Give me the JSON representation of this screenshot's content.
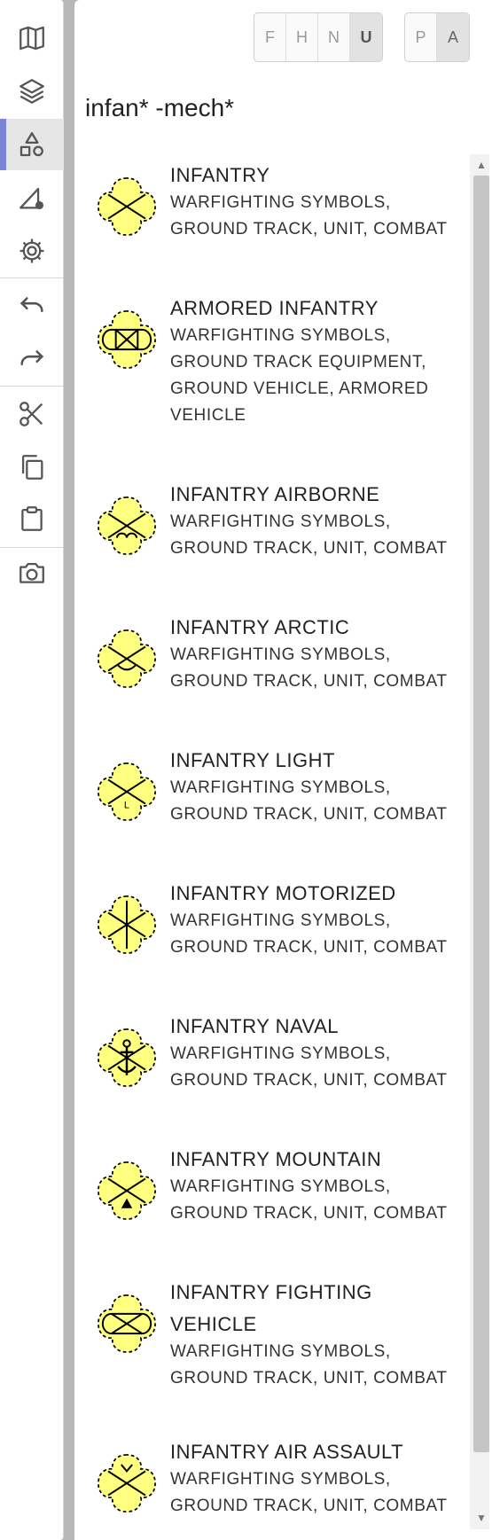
{
  "toolbar": {
    "tools": [
      {
        "name": "map-icon",
        "label": "map"
      },
      {
        "name": "layers-icon",
        "label": "layers"
      },
      {
        "name": "shapes-icon",
        "label": "shapes"
      },
      {
        "name": "draw-settings-icon",
        "label": "draw settings"
      },
      {
        "name": "gear-icon",
        "label": "settings"
      },
      {
        "name": "undo-icon",
        "label": "undo"
      },
      {
        "name": "redo-icon",
        "label": "redo"
      },
      {
        "name": "scissors-icon",
        "label": "cut"
      },
      {
        "name": "copy-icon",
        "label": "copy"
      },
      {
        "name": "clipboard-icon",
        "label": "paste"
      },
      {
        "name": "camera-icon",
        "label": "snapshot"
      }
    ],
    "active_tool": "shapes-icon"
  },
  "identity_filter": {
    "options": [
      "F",
      "H",
      "N",
      "U"
    ],
    "selected": "U"
  },
  "status_filter": {
    "options": [
      "P",
      "A"
    ],
    "selected": "A"
  },
  "search": {
    "value": "infan* -mech*"
  },
  "results": [
    {
      "title": "INFANTRY",
      "sub": [
        "WARFIGHTING SYMBOLS,",
        "GROUND TRACK, UNIT, COMBAT"
      ],
      "symbol": "infantry"
    },
    {
      "title": "ARMORED INFANTRY",
      "sub": [
        "WARFIGHTING SYMBOLS,",
        "GROUND TRACK EQUIPMENT,",
        "GROUND VEHICLE, ARMORED",
        "VEHICLE"
      ],
      "symbol": "armored"
    },
    {
      "title": "INFANTRY AIRBORNE",
      "sub": [
        "WARFIGHTING SYMBOLS,",
        "GROUND TRACK, UNIT, COMBAT"
      ],
      "symbol": "airborne"
    },
    {
      "title": "INFANTRY ARCTIC",
      "sub": [
        "WARFIGHTING SYMBOLS,",
        "GROUND TRACK, UNIT, COMBAT"
      ],
      "symbol": "arctic"
    },
    {
      "title": "INFANTRY LIGHT",
      "sub": [
        "WARFIGHTING SYMBOLS,",
        "GROUND TRACK, UNIT, COMBAT"
      ],
      "symbol": "light"
    },
    {
      "title": "INFANTRY MOTORIZED",
      "sub": [
        "WARFIGHTING SYMBOLS,",
        "GROUND TRACK, UNIT, COMBAT"
      ],
      "symbol": "motorized"
    },
    {
      "title": "INFANTRY NAVAL",
      "sub": [
        "WARFIGHTING SYMBOLS,",
        "GROUND TRACK, UNIT, COMBAT"
      ],
      "symbol": "naval"
    },
    {
      "title": "INFANTRY MOUNTAIN",
      "sub": [
        "WARFIGHTING SYMBOLS,",
        "GROUND TRACK, UNIT, COMBAT"
      ],
      "symbol": "mountain"
    },
    {
      "title": [
        "INFANTRY FIGHTING",
        "VEHICLE"
      ],
      "sub": [
        "WARFIGHTING SYMBOLS,",
        "GROUND TRACK, UNIT, COMBAT"
      ],
      "symbol": "ifv"
    },
    {
      "title": "INFANTRY AIR ASSAULT",
      "sub": [
        "WARFIGHTING SYMBOLS,",
        "GROUND TRACK, UNIT, COMBAT"
      ],
      "symbol": "airassault"
    }
  ],
  "colors": {
    "symbol_fill": "#ffff80",
    "active_accent": "#7b86d6"
  }
}
